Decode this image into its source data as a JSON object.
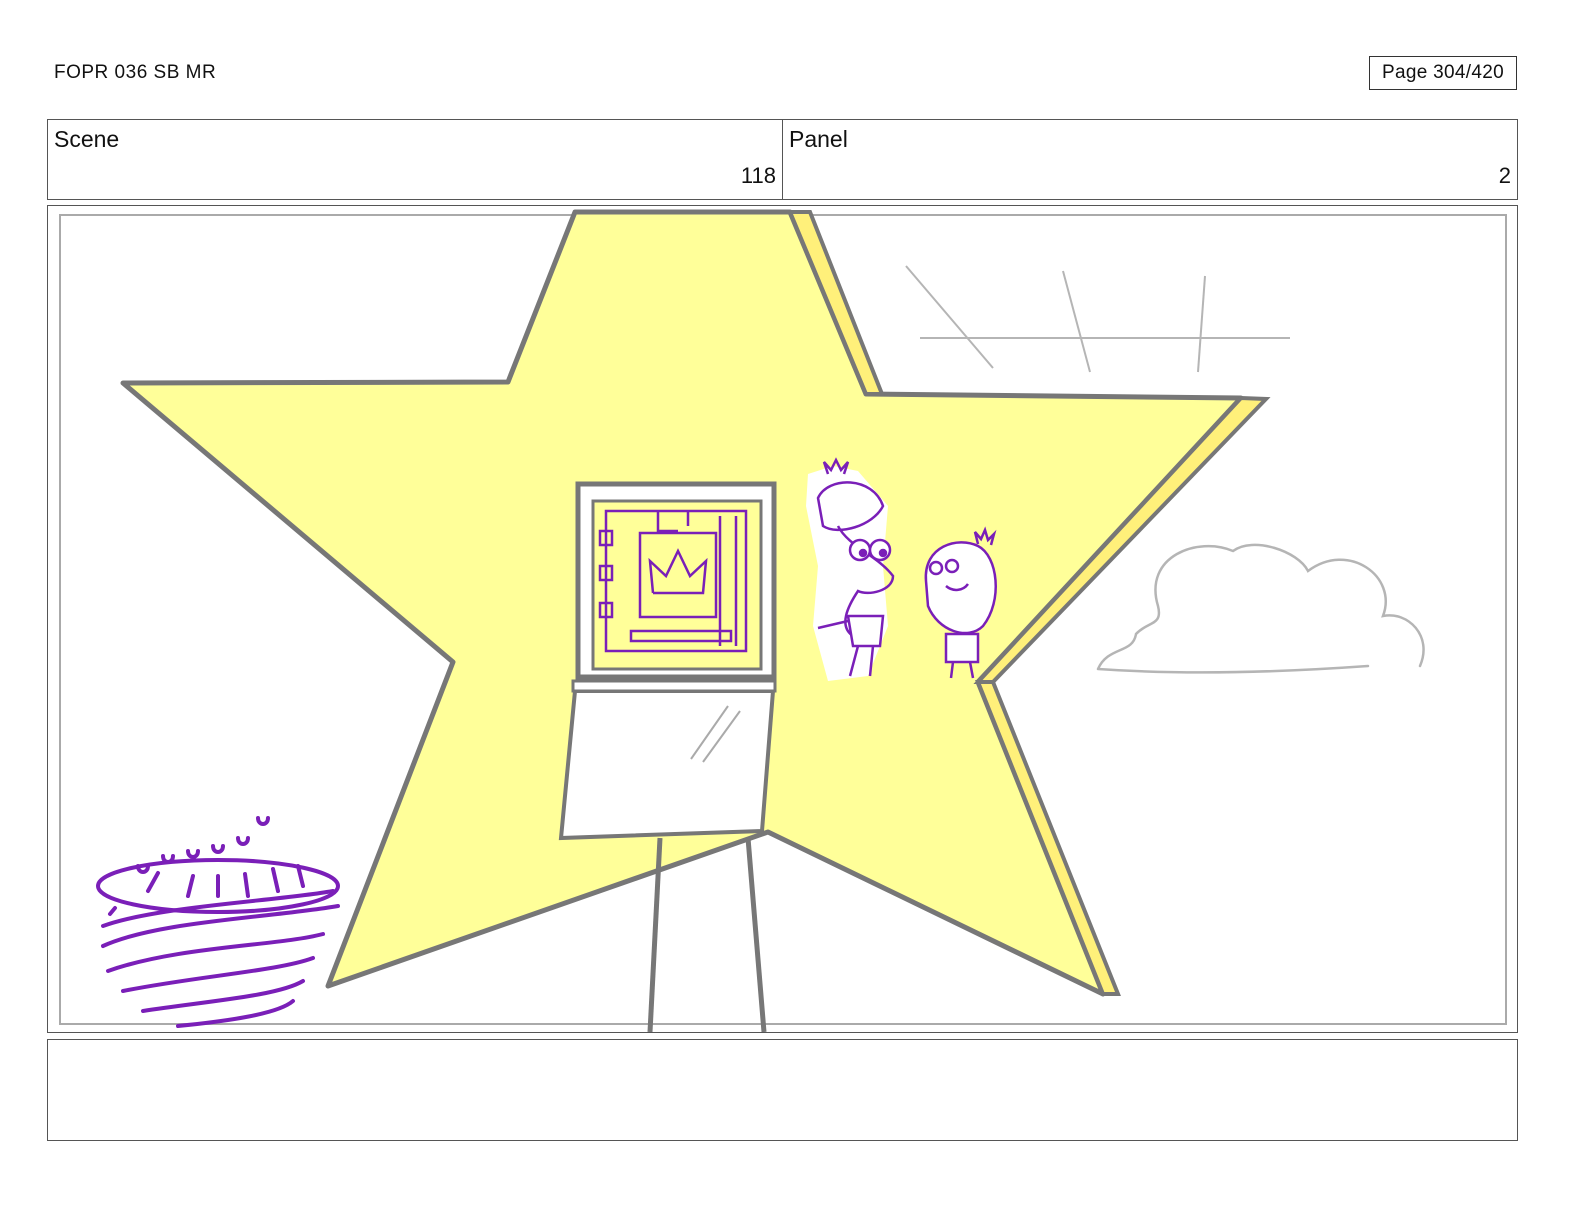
{
  "header": {
    "doc_id": "FOPR 036 SB MR",
    "page_label": "Page 304/420"
  },
  "scene": {
    "label": "Scene",
    "value": "118"
  },
  "panel": {
    "label": "Panel",
    "value": "2"
  },
  "colors": {
    "star_fill": "#ffff99",
    "sketch_purple": "#7a1fb8",
    "line_gray": "#777777",
    "light_gray": "#b5b5b5"
  }
}
